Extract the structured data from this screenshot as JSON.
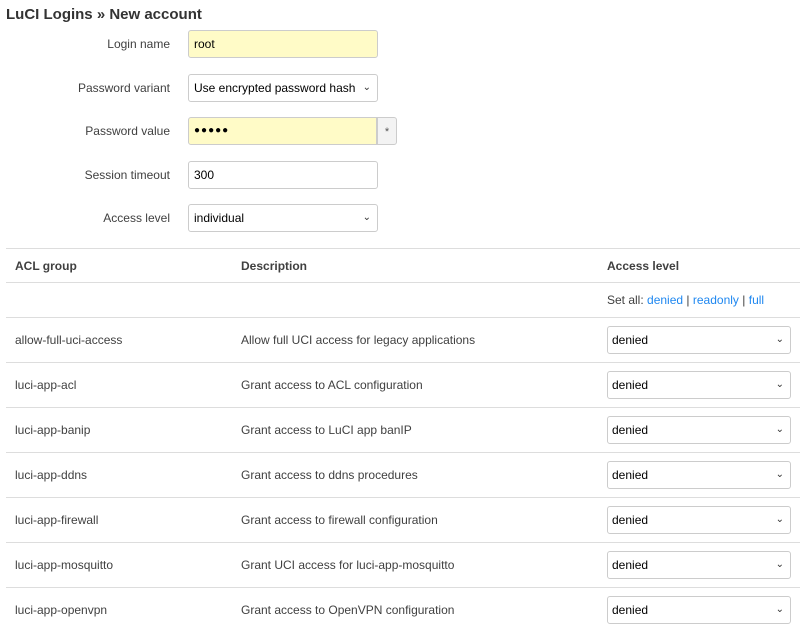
{
  "title": "LuCI Logins » New account",
  "form": {
    "login_name": {
      "label": "Login name",
      "value": "root"
    },
    "password_variant": {
      "label": "Password variant",
      "value": "Use encrypted password hash"
    },
    "password_value": {
      "label": "Password value",
      "value": "●●●●●",
      "reveal": "*"
    },
    "session_timeout": {
      "label": "Session timeout",
      "value": "300"
    },
    "access_level": {
      "label": "Access level",
      "value": "individual"
    }
  },
  "table": {
    "headers": [
      "ACL group",
      "Description",
      "Access level"
    ],
    "set_all": {
      "label": "Set all:",
      "denied": "denied",
      "readonly": "readonly",
      "full": "full",
      "sep": "|"
    },
    "rows": [
      {
        "group": "allow-full-uci-access",
        "desc": "Allow full UCI access for legacy applications",
        "level": "denied"
      },
      {
        "group": "luci-app-acl",
        "desc": "Grant access to ACL configuration",
        "level": "denied"
      },
      {
        "group": "luci-app-banip",
        "desc": "Grant access to LuCI app banIP",
        "level": "denied"
      },
      {
        "group": "luci-app-ddns",
        "desc": "Grant access to ddns procedures",
        "level": "denied"
      },
      {
        "group": "luci-app-firewall",
        "desc": "Grant access to firewall configuration",
        "level": "denied"
      },
      {
        "group": "luci-app-mosquitto",
        "desc": "Grant UCI access for luci-app-mosquitto",
        "level": "denied"
      },
      {
        "group": "luci-app-openvpn",
        "desc": "Grant access to OpenVPN configuration",
        "level": "denied"
      }
    ]
  }
}
